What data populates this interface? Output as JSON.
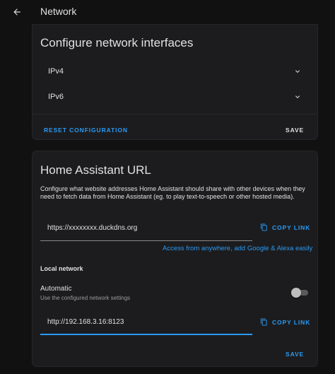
{
  "header": {
    "title": "Network",
    "back_icon": "arrow-left-icon"
  },
  "interfaces": {
    "title": "Configure network interfaces",
    "items": [
      {
        "label": "IPv4"
      },
      {
        "label": "IPv6"
      }
    ],
    "reset_label": "RESET CONFIGURATION",
    "save_label": "SAVE"
  },
  "url_card": {
    "title": "Home Assistant URL",
    "description": "Configure what website addresses Home Assistant should share with other devices when they need to fetch data from Home Assistant (eg. to play text-to-speech or other hosted media).",
    "external": {
      "value": "https://xxxxxxxx.duckdns.org",
      "copy_label": "COPY LINK",
      "link_text": "Access from anywhere, add Google & Alexa easily"
    },
    "local": {
      "heading": "Local network",
      "automatic_label": "Automatic",
      "automatic_sub": "Use the configured network settings",
      "automatic_on": false,
      "value": "http://192.168.3.16:8123",
      "copy_label": "COPY LINK"
    },
    "save_label": "SAVE"
  },
  "colors": {
    "accent": "#2b9af3",
    "card": "#1c1c1e",
    "background": "#111111"
  }
}
